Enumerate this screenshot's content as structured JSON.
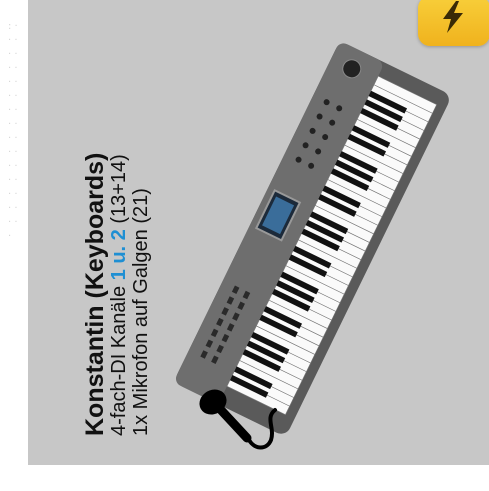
{
  "app_icon": {
    "icon": "lightning-icon",
    "color": "#f2b81e"
  },
  "label": {
    "title": "Konstantin (Keyboards)",
    "line1_prefix": "4-fach-DI Kanäle ",
    "line1_accent": "1 u. 2",
    "line1_suffix": " (13+14)",
    "line2": "1x Mikrofon auf Galgen (21)",
    "accent_color": "#1e8fd3"
  },
  "images": {
    "keyboard": "keyboard-image",
    "microphone": "microphone-icon"
  }
}
